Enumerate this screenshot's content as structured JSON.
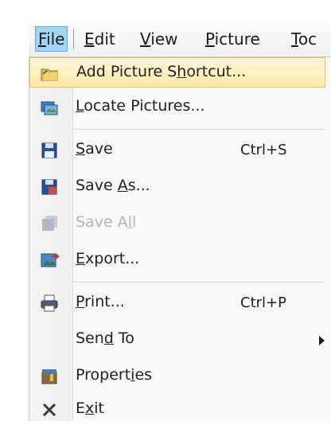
{
  "menubar": {
    "file": {
      "mn": "F",
      "rest": "ile"
    },
    "edit": {
      "mn": "E",
      "rest": "dit"
    },
    "view": {
      "mn": "V",
      "rest": "iew"
    },
    "picture": {
      "mn": "P",
      "rest": "icture"
    },
    "tools": {
      "mn": "T",
      "rest": "oc"
    }
  },
  "menu": {
    "add_shortcut": {
      "a": "Add Picture S",
      "m": "h",
      "b": "ortcut..."
    },
    "locate": {
      "a": "",
      "m": "L",
      "b": "ocate Pictures..."
    },
    "save": {
      "a": "",
      "m": "S",
      "b": "ave",
      "shortcut": "Ctrl+S"
    },
    "save_as": {
      "a": "Save ",
      "m": "A",
      "b": "s..."
    },
    "save_all": {
      "a": "Save A",
      "m": "l",
      "b": "l"
    },
    "export": {
      "a": "",
      "m": "E",
      "b": "xport..."
    },
    "print": {
      "a": "",
      "m": "P",
      "b": "rint...",
      "shortcut": "Ctrl+P"
    },
    "send_to": {
      "a": "Sen",
      "m": "d",
      "b": " To"
    },
    "properties": {
      "a": "Propert",
      "m": "i",
      "b": "es"
    },
    "exit": {
      "a": "E",
      "m": "x",
      "b": "it"
    }
  },
  "icons": {
    "add_shortcut": "folder-add-icon",
    "locate": "locate-pictures-icon",
    "save": "floppy-disk-icon",
    "save_as": "save-as-icon",
    "save_all": "save-all-icon",
    "export": "export-icon",
    "print": "printer-icon",
    "properties": "properties-icon",
    "exit": "close-x-icon"
  },
  "colors": {
    "menubar_selected": "#9fd6f8",
    "item_highlight": "#ffe9a6",
    "disabled_text": "#b4b4b4"
  }
}
